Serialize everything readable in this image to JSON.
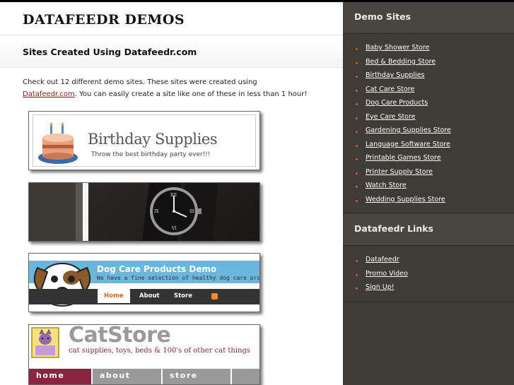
{
  "site": {
    "title": "DATAFEEDR DEMOS"
  },
  "page": {
    "heading": "Sites Created Using Datafeedr.com",
    "intro_before": "Check out 12 different demo sites. These sites were created using ",
    "intro_link": "Datafeedr.com",
    "intro_after": ". You can easily create a site like one of these in less than 1 hour!"
  },
  "thumbnails": {
    "birthday": {
      "title": "Birthday Supplies",
      "tagline": "Throw the best birthday party ever!!!"
    },
    "dog": {
      "title": "Dog Care Products Demo",
      "tagline": "We have a fine selection of healthy dog care products",
      "nav": [
        "Home",
        "About",
        "Store"
      ]
    },
    "cat": {
      "title": "CatStore",
      "tagline": "cat supplies, toys, beds & 100's of other cat things",
      "nav": [
        "home",
        "about",
        "store"
      ]
    }
  },
  "sidebar": {
    "demo_heading": "Demo Sites",
    "demo_sites": [
      "Baby Shower Store",
      "Bed & Bedding Store",
      "Birthday Supplies",
      "Cat Care Store",
      "Dog Care Products",
      "Eye Care Store",
      "Gardening Supplies Store",
      "Language Software Store",
      "Printable Games Store",
      "Printer Supply Store",
      "Watch Store",
      "Wedding Supplies Store"
    ],
    "links_heading": "Datafeedr Links",
    "links": [
      "Datafeedr",
      "Promo Video",
      "Sign Up!"
    ]
  },
  "colors": {
    "sidebar_bg": "#3f3b37",
    "link_accent": "#8b1a1a",
    "bullet": "#d2552d"
  },
  "icons": [
    "cake-icon",
    "watch-icon",
    "dog-icon",
    "cat-icon",
    "rss-icon"
  ]
}
